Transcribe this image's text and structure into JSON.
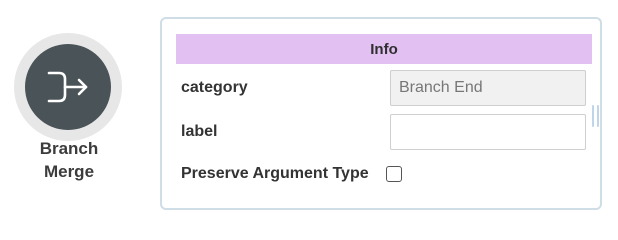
{
  "node": {
    "icon": "branch-merge-icon",
    "label_line1": "Branch",
    "label_line2": "Merge"
  },
  "panel": {
    "title": "Info",
    "fields": {
      "category": {
        "label": "category",
        "value": "Branch End"
      },
      "label": {
        "label": "label",
        "value": ""
      },
      "preserve": {
        "label": "Preserve Argument Type",
        "checked": false
      }
    }
  },
  "colors": {
    "header_bg": "#e2c0f2",
    "node_dark": "#4a5357",
    "node_ring": "#e7e7e7",
    "panel_border": "#cfdde6"
  }
}
